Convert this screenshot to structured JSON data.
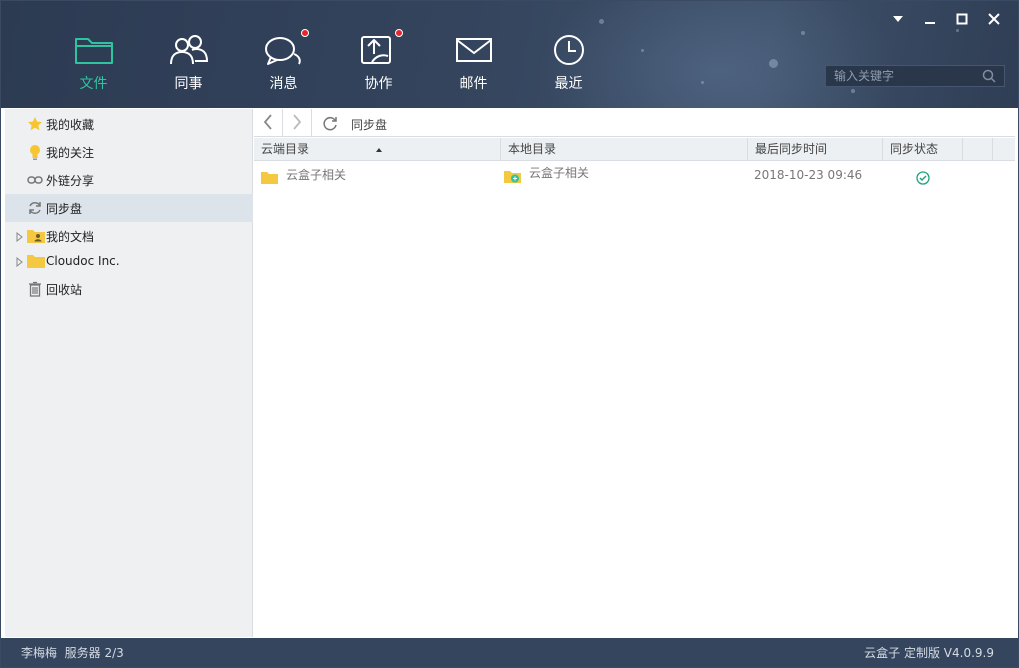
{
  "nav": {
    "items": [
      {
        "label": "文件",
        "icon": "folder-icon",
        "active": true
      },
      {
        "label": "同事",
        "icon": "contacts-icon"
      },
      {
        "label": "消息",
        "icon": "chat-icon",
        "badge": true
      },
      {
        "label": "协作",
        "icon": "collaboration-icon",
        "badge": true
      },
      {
        "label": "邮件",
        "icon": "mail-icon"
      },
      {
        "label": "最近",
        "icon": "clock-icon"
      }
    ]
  },
  "search": {
    "placeholder": "输入关键字"
  },
  "sidebar": {
    "items": [
      {
        "label": "我的收藏",
        "icon": "star-icon"
      },
      {
        "label": "我的关注",
        "icon": "lightbulb-icon"
      },
      {
        "label": "外链分享",
        "icon": "link-icon"
      },
      {
        "label": "同步盘",
        "icon": "sync-icon",
        "selected": true
      },
      {
        "label": "我的文档",
        "icon": "user-folder-icon"
      },
      {
        "label": "Cloudoc Inc.",
        "icon": "folder-icon"
      },
      {
        "label": "回收站",
        "icon": "trash-icon"
      }
    ]
  },
  "toolbar": {
    "path": "同步盘"
  },
  "table": {
    "headers": [
      "云端目录",
      "本地目录",
      "最后同步时间",
      "同步状态"
    ],
    "rows": [
      {
        "cloud_dir": "云盒子相关",
        "local_dir": "云盒子相关",
        "last_sync": "2018-10-23 09:46",
        "status": "synced"
      }
    ]
  },
  "status": {
    "user": "李梅梅",
    "server": "服务器 2/3",
    "version": "云盒子 定制版 V4.0.9.9"
  },
  "colors": {
    "header_bg": "#34445d",
    "active_nav": "#2ec4a0",
    "badge": "#e3262f",
    "folder": "#f5c842",
    "sync_ok": "#1aa37a",
    "statusbar_bg": "#34455d"
  }
}
